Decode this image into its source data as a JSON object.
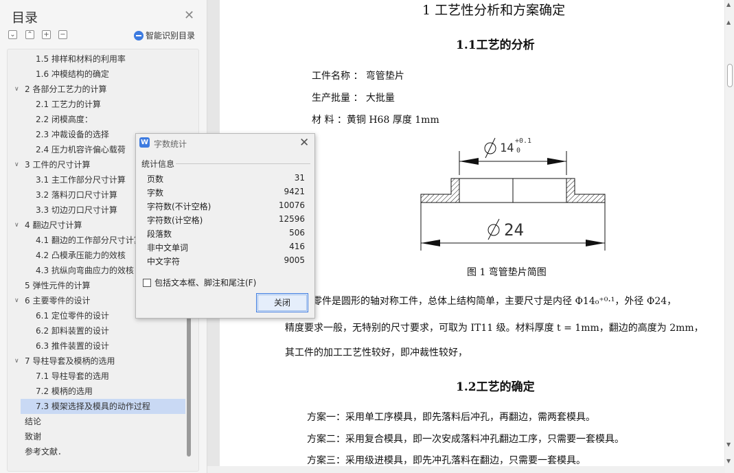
{
  "toc": {
    "title": "目录",
    "smart_label": "智能识别目录",
    "items": [
      {
        "text": "1.5 排样和材料的利用率",
        "level": 2
      },
      {
        "text": "1.6 冲模结构的确定",
        "level": 2
      },
      {
        "text": "2  各部分工艺力的计算",
        "level": 1,
        "expanded": true
      },
      {
        "text": "2.1 工艺力的计算",
        "level": 2
      },
      {
        "text": "2.2 闭模高度：",
        "level": 2
      },
      {
        "text": "2.3 冲裁设备的选择",
        "level": 2
      },
      {
        "text": "2.4 压力机容许偏心载荷",
        "level": 2
      },
      {
        "text": "3  工件的尺寸计算",
        "level": 1,
        "expanded": true
      },
      {
        "text": "3.1 主工作部分尺寸计算",
        "level": 2
      },
      {
        "text": "3.2 落料刃口尺寸计算",
        "level": 2
      },
      {
        "text": "3.3 切边刃口尺寸计算",
        "level": 2
      },
      {
        "text": "4  翻边尺寸计算",
        "level": 1,
        "expanded": true
      },
      {
        "text": "4.1 翻边的工作部分尺寸计算",
        "level": 2
      },
      {
        "text": "4.2 凸模承压能力的效核",
        "level": 2
      },
      {
        "text": "4.3 抗纵向弯曲应力的效核",
        "level": 2
      },
      {
        "text": "5  弹性元件的计算",
        "level": 1,
        "expanded": false
      },
      {
        "text": "6  主要零件的设计",
        "level": 1,
        "expanded": true
      },
      {
        "text": "6.1 定位零件的设计",
        "level": 2
      },
      {
        "text": "6.2 卸料装置的设计",
        "level": 2
      },
      {
        "text": "6.3 推件装置的设计",
        "level": 2
      },
      {
        "text": "7  导柱导套及模柄的选用",
        "level": 1,
        "expanded": true
      },
      {
        "text": "7.1 导柱导套的选用",
        "level": 2
      },
      {
        "text": "7.2 模柄的选用",
        "level": 2
      },
      {
        "text": "7.3 模架选择及模具的动作过程",
        "level": 2,
        "selected": true
      },
      {
        "text": "结论",
        "level": 1,
        "expanded": false
      },
      {
        "text": "致谢",
        "level": 1,
        "expanded": false
      },
      {
        "text": "参考文献．",
        "level": 1,
        "expanded": false
      }
    ]
  },
  "doc": {
    "heading1": "1  工艺性分析和方案确定",
    "heading2a": "1.1工艺的分析",
    "part_name": "工件名称 ： 弯管垫片",
    "batch": "生产批量 ：  大批量",
    "material": "材     料 ：黄铜 H68       厚度 1mm",
    "figure": {
      "top_dim": "14",
      "tol_upper": "+0.1",
      "tol_lower": "0",
      "bottom_dim": "24",
      "caption": "图 1  弯管垫片简图"
    },
    "para1_a": "零件是圆形的轴对称工件，总体上结构简单，主要尺寸是内径 Φ14₀⁺⁰·¹，外径 Φ24，",
    "para1_b": "精度要求一般，无特别的尺寸要求，可取为 IT11 级。材料厚度 t = 1mm，翻边的高度为 2mm，",
    "para1_c": "其工件的加工工艺性较好，即冲裁性较好，",
    "heading2b": "1.2工艺的确定",
    "plan1": "方案一：采用单工序模具，即先落料后冲孔，再翻边，需两套模具。",
    "plan2": "方案二：采用复合模具，即一次安成落料冲孔翻边工序，只需要一套模具。",
    "plan3": "方案三：采用级进模具，即先冲孔落料在翻边，只需要一套模具。"
  },
  "dialog": {
    "title": "字数统计",
    "logo": "W",
    "section": "统计信息",
    "stats": [
      {
        "label": "页数",
        "value": "31"
      },
      {
        "label": "字数",
        "value": "9421"
      },
      {
        "label": "字符数(不计空格)",
        "value": "10076"
      },
      {
        "label": "字符数(计空格)",
        "value": "12596"
      },
      {
        "label": "段落数",
        "value": "506"
      },
      {
        "label": "非中文单词",
        "value": "416"
      },
      {
        "label": "中文字符",
        "value": "9005"
      }
    ],
    "checkbox_label": "包括文本框、脚注和尾注(F)",
    "close_button": "关闭"
  },
  "colors": {
    "accent": "#3d7be0",
    "selected_row": "#c9d9f4"
  }
}
